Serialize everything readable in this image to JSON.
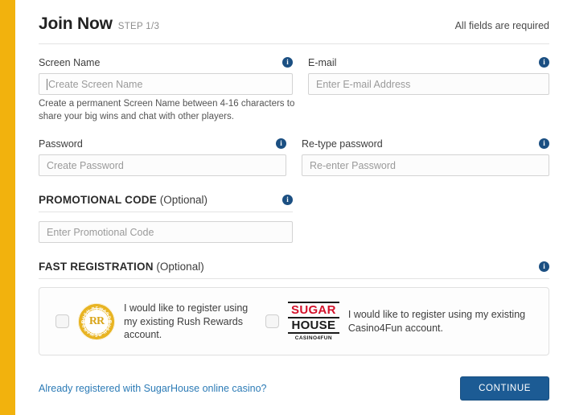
{
  "accent_color": "#f2b20d",
  "header": {
    "title": "Join Now",
    "step": "STEP 1/3",
    "all_fields_required": "All fields are required"
  },
  "fields": {
    "screen_name": {
      "label": "Screen Name",
      "placeholder": "Create Screen Name",
      "value": "",
      "info_icon": "info-icon",
      "helper": "Create a permanent Screen Name between 4-16 characters to share your big wins and chat with other players."
    },
    "email": {
      "label": "E-mail",
      "placeholder": "Enter E-mail Address",
      "value": "",
      "info_icon": "info-icon"
    },
    "password": {
      "label": "Password",
      "placeholder": "Create Password",
      "value": "",
      "info_icon": "info-icon"
    },
    "retype_password": {
      "label": "Re-type password",
      "placeholder": "Re-enter Password",
      "value": "",
      "info_icon": "info-icon"
    }
  },
  "promotional": {
    "title": "PROMOTIONAL CODE",
    "optional": "(Optional)",
    "placeholder": "Enter Promotional Code",
    "value": "",
    "info_icon": "info-icon"
  },
  "fast_registration": {
    "title": "FAST REGISTRATION",
    "optional": "(Optional)",
    "info_icon": "info-icon",
    "options": [
      {
        "logo": "rush-rewards-logo",
        "logo_text": "RUSH REWARDS",
        "monogram": "RR",
        "label": "I would like to register using my existing Rush Rewards account.",
        "checked": false
      },
      {
        "logo": "sugarhouse-casino4fun-logo",
        "logo_line1": "SUGAR",
        "logo_line2": "HOUSE",
        "logo_line3": "CASINO4FUN",
        "label": "I would like to register using my existing Casino4Fun account.",
        "checked": false
      }
    ]
  },
  "footer": {
    "login_link": "Already registered with SugarHouse online casino?",
    "continue_label": "CONTINUE",
    "continue_color": "#1c5b94",
    "link_color": "#2c7bb6"
  }
}
